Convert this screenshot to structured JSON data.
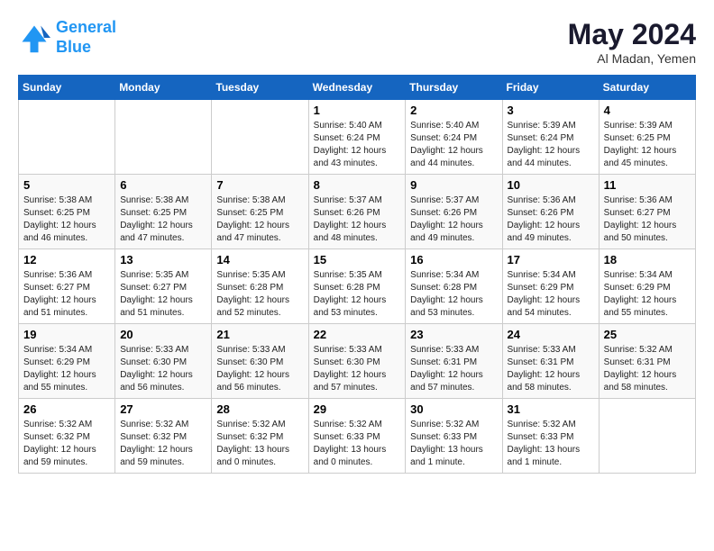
{
  "logo": {
    "line1": "General",
    "line2": "Blue"
  },
  "title": {
    "main": "May 2024",
    "sub": "Al Madan, Yemen"
  },
  "days_of_week": [
    "Sunday",
    "Monday",
    "Tuesday",
    "Wednesday",
    "Thursday",
    "Friday",
    "Saturday"
  ],
  "weeks": [
    [
      {
        "day": "",
        "info": ""
      },
      {
        "day": "",
        "info": ""
      },
      {
        "day": "",
        "info": ""
      },
      {
        "day": "1",
        "info": "Sunrise: 5:40 AM\nSunset: 6:24 PM\nDaylight: 12 hours\nand 43 minutes."
      },
      {
        "day": "2",
        "info": "Sunrise: 5:40 AM\nSunset: 6:24 PM\nDaylight: 12 hours\nand 44 minutes."
      },
      {
        "day": "3",
        "info": "Sunrise: 5:39 AM\nSunset: 6:24 PM\nDaylight: 12 hours\nand 44 minutes."
      },
      {
        "day": "4",
        "info": "Sunrise: 5:39 AM\nSunset: 6:25 PM\nDaylight: 12 hours\nand 45 minutes."
      }
    ],
    [
      {
        "day": "5",
        "info": "Sunrise: 5:38 AM\nSunset: 6:25 PM\nDaylight: 12 hours\nand 46 minutes."
      },
      {
        "day": "6",
        "info": "Sunrise: 5:38 AM\nSunset: 6:25 PM\nDaylight: 12 hours\nand 47 minutes."
      },
      {
        "day": "7",
        "info": "Sunrise: 5:38 AM\nSunset: 6:25 PM\nDaylight: 12 hours\nand 47 minutes."
      },
      {
        "day": "8",
        "info": "Sunrise: 5:37 AM\nSunset: 6:26 PM\nDaylight: 12 hours\nand 48 minutes."
      },
      {
        "day": "9",
        "info": "Sunrise: 5:37 AM\nSunset: 6:26 PM\nDaylight: 12 hours\nand 49 minutes."
      },
      {
        "day": "10",
        "info": "Sunrise: 5:36 AM\nSunset: 6:26 PM\nDaylight: 12 hours\nand 49 minutes."
      },
      {
        "day": "11",
        "info": "Sunrise: 5:36 AM\nSunset: 6:27 PM\nDaylight: 12 hours\nand 50 minutes."
      }
    ],
    [
      {
        "day": "12",
        "info": "Sunrise: 5:36 AM\nSunset: 6:27 PM\nDaylight: 12 hours\nand 51 minutes."
      },
      {
        "day": "13",
        "info": "Sunrise: 5:35 AM\nSunset: 6:27 PM\nDaylight: 12 hours\nand 51 minutes."
      },
      {
        "day": "14",
        "info": "Sunrise: 5:35 AM\nSunset: 6:28 PM\nDaylight: 12 hours\nand 52 minutes."
      },
      {
        "day": "15",
        "info": "Sunrise: 5:35 AM\nSunset: 6:28 PM\nDaylight: 12 hours\nand 53 minutes."
      },
      {
        "day": "16",
        "info": "Sunrise: 5:34 AM\nSunset: 6:28 PM\nDaylight: 12 hours\nand 53 minutes."
      },
      {
        "day": "17",
        "info": "Sunrise: 5:34 AM\nSunset: 6:29 PM\nDaylight: 12 hours\nand 54 minutes."
      },
      {
        "day": "18",
        "info": "Sunrise: 5:34 AM\nSunset: 6:29 PM\nDaylight: 12 hours\nand 55 minutes."
      }
    ],
    [
      {
        "day": "19",
        "info": "Sunrise: 5:34 AM\nSunset: 6:29 PM\nDaylight: 12 hours\nand 55 minutes."
      },
      {
        "day": "20",
        "info": "Sunrise: 5:33 AM\nSunset: 6:30 PM\nDaylight: 12 hours\nand 56 minutes."
      },
      {
        "day": "21",
        "info": "Sunrise: 5:33 AM\nSunset: 6:30 PM\nDaylight: 12 hours\nand 56 minutes."
      },
      {
        "day": "22",
        "info": "Sunrise: 5:33 AM\nSunset: 6:30 PM\nDaylight: 12 hours\nand 57 minutes."
      },
      {
        "day": "23",
        "info": "Sunrise: 5:33 AM\nSunset: 6:31 PM\nDaylight: 12 hours\nand 57 minutes."
      },
      {
        "day": "24",
        "info": "Sunrise: 5:33 AM\nSunset: 6:31 PM\nDaylight: 12 hours\nand 58 minutes."
      },
      {
        "day": "25",
        "info": "Sunrise: 5:32 AM\nSunset: 6:31 PM\nDaylight: 12 hours\nand 58 minutes."
      }
    ],
    [
      {
        "day": "26",
        "info": "Sunrise: 5:32 AM\nSunset: 6:32 PM\nDaylight: 12 hours\nand 59 minutes."
      },
      {
        "day": "27",
        "info": "Sunrise: 5:32 AM\nSunset: 6:32 PM\nDaylight: 12 hours\nand 59 minutes."
      },
      {
        "day": "28",
        "info": "Sunrise: 5:32 AM\nSunset: 6:32 PM\nDaylight: 13 hours\nand 0 minutes."
      },
      {
        "day": "29",
        "info": "Sunrise: 5:32 AM\nSunset: 6:33 PM\nDaylight: 13 hours\nand 0 minutes."
      },
      {
        "day": "30",
        "info": "Sunrise: 5:32 AM\nSunset: 6:33 PM\nDaylight: 13 hours\nand 1 minute."
      },
      {
        "day": "31",
        "info": "Sunrise: 5:32 AM\nSunset: 6:33 PM\nDaylight: 13 hours\nand 1 minute."
      },
      {
        "day": "",
        "info": ""
      }
    ]
  ]
}
